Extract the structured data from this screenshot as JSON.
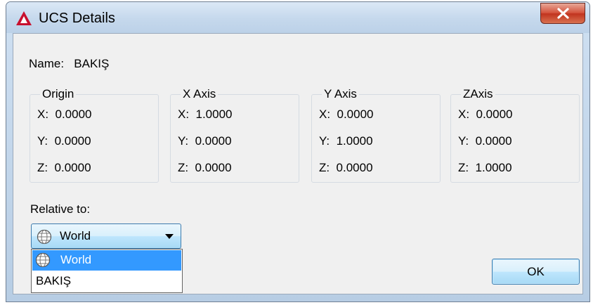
{
  "window": {
    "title": "UCS Details"
  },
  "name": {
    "label": "Name:",
    "value": "BAKIŞ"
  },
  "groups": [
    {
      "label": "Origin",
      "x": "X:  0.0000",
      "y": "Y:  0.0000",
      "z": "Z:  0.0000"
    },
    {
      "label": "X Axis",
      "x": "X:  1.0000",
      "y": "Y:  0.0000",
      "z": "Z:  0.0000"
    },
    {
      "label": "Y Axis",
      "x": "X:  0.0000",
      "y": "Y:  1.0000",
      "z": "Z:  0.0000"
    },
    {
      "label": "ZAxis",
      "x": "X:  0.0000",
      "y": "Y:  0.0000",
      "z": "Z:  1.0000"
    }
  ],
  "relative_to": {
    "label": "Relative to:",
    "selected": "World",
    "options": [
      "World",
      "BAKIŞ"
    ]
  },
  "buttons": {
    "ok": "OK"
  },
  "icons": {
    "app": "autocad-logo-icon",
    "close": "close-icon",
    "world": "world-ucs-icon",
    "dropdown": "chevron-down-icon"
  },
  "colors": {
    "selection": "#3399ff",
    "close_button": "#c9402a",
    "window_frame": "#bcd1e8"
  }
}
